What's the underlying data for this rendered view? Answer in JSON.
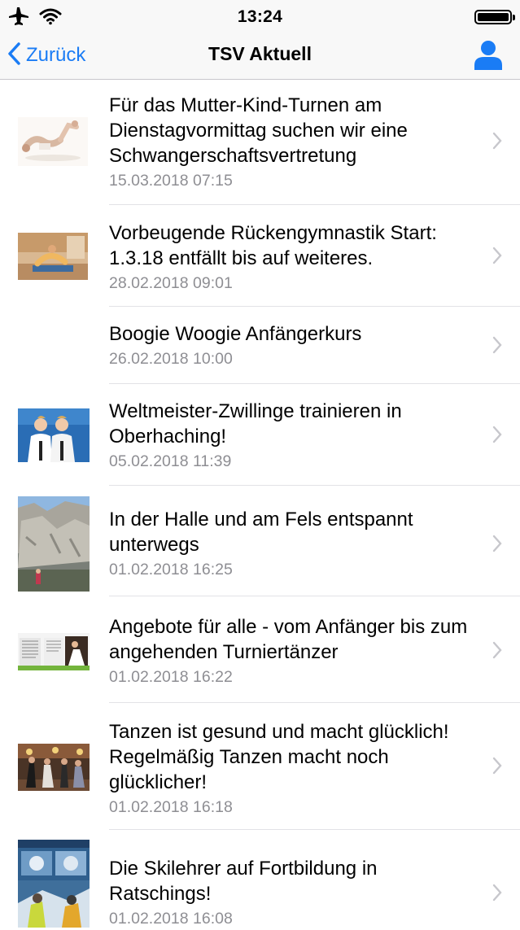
{
  "status_bar": {
    "time": "13:24"
  },
  "nav": {
    "back_label": "Zurück",
    "title": "TSV Aktuell"
  },
  "news": [
    {
      "title": "Für das Mutter-Kind-Turnen am Dienstagvormittag suchen wir eine Schwangerschaftsvertretung",
      "date": "15.03.2018 07:15"
    },
    {
      "title": "Vorbeugende Rückengymnastik Start: 1.3.18 entfällt bis auf weiteres.",
      "date": "28.02.2018 09:01"
    },
    {
      "title": "Boogie Woogie Anfängerkurs",
      "date": "26.02.2018 10:00"
    },
    {
      "title": "Weltmeister-Zwillinge trainieren in Oberhaching!",
      "date": "05.02.2018 11:39"
    },
    {
      "title": "In der Halle und am Fels entspannt unterwegs",
      "date": "01.02.2018 16:25"
    },
    {
      "title": "Angebote für alle - vom Anfänger bis zum angehenden Turniertänzer",
      "date": "01.02.2018 16:22"
    },
    {
      "title": "Tanzen ist gesund und macht glücklich! Regelmäßig Tanzen macht noch glücklicher!",
      "date": "01.02.2018 16:18"
    },
    {
      "title": "Die Skilehrer auf Fortbildung in Ratschings!",
      "date": "01.02.2018 16:08"
    }
  ]
}
